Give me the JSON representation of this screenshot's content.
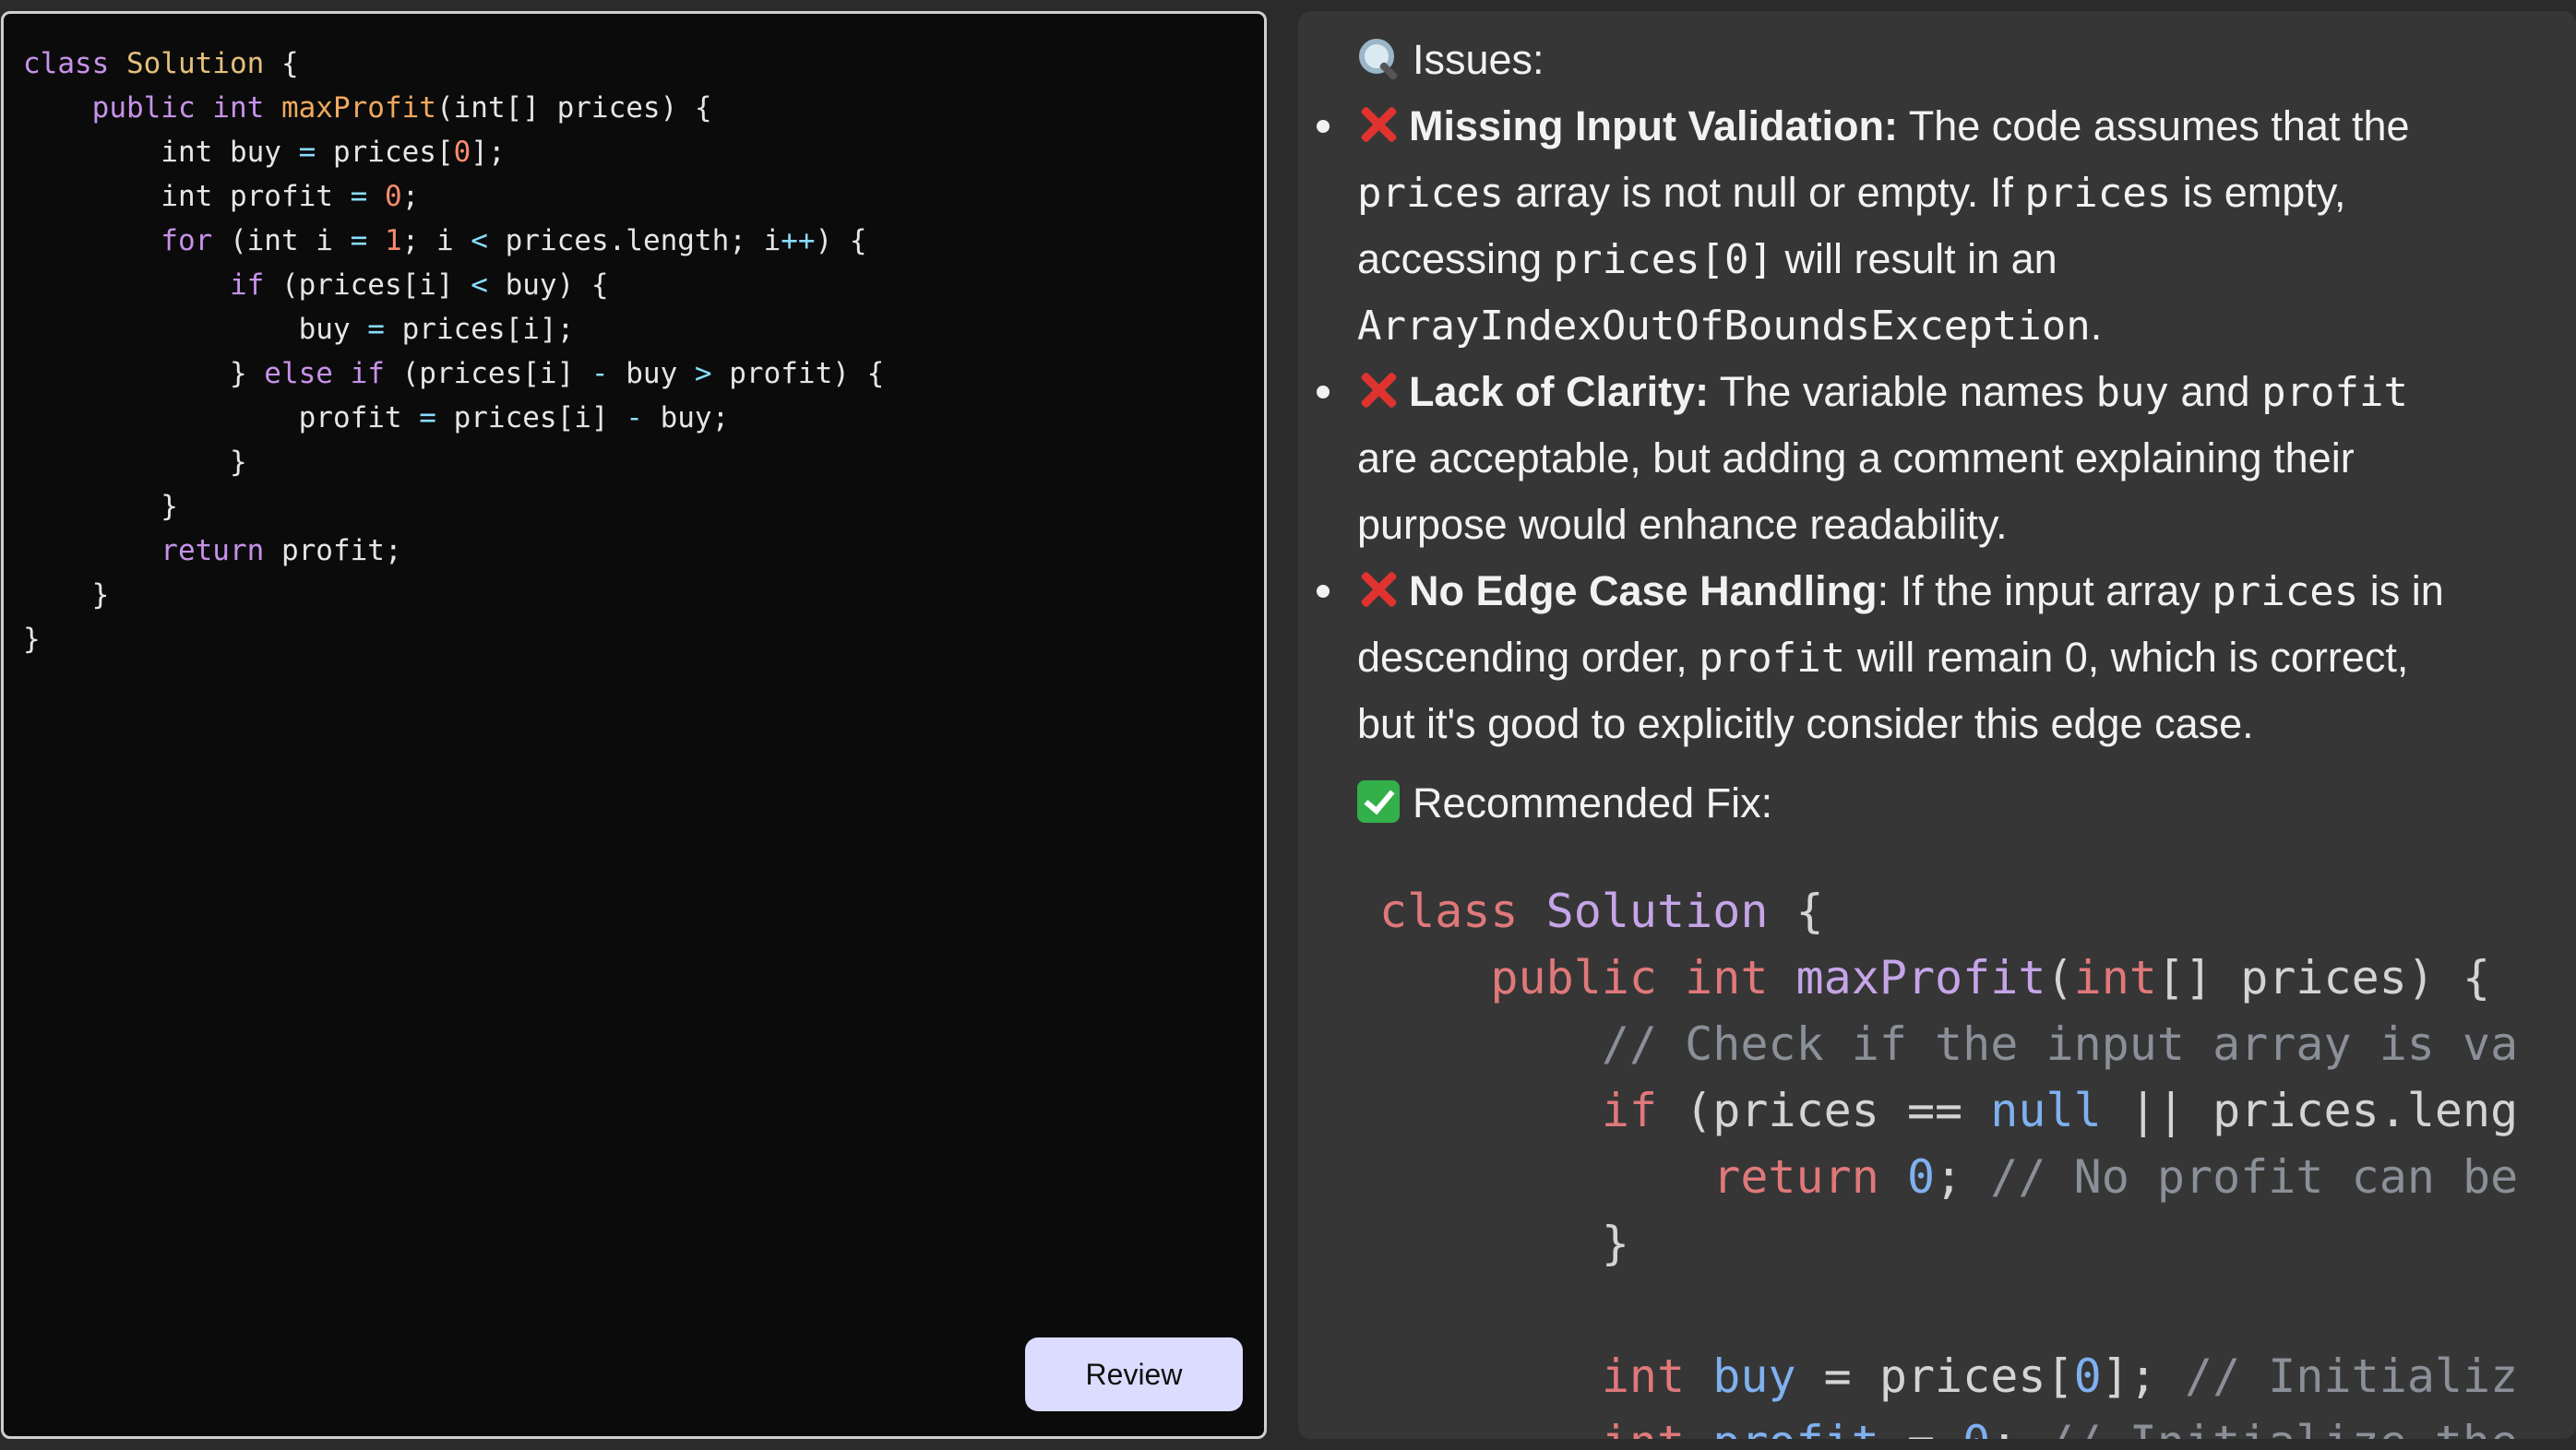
{
  "editor": {
    "colors": {
      "keyword": "#c792ea",
      "className": "#e5c07b",
      "method": "#f0a860",
      "number": "#f78c6c",
      "operator": "#89ddff",
      "plain": "#e6e6e6"
    },
    "code_lines": [
      [
        {
          "t": "class ",
          "c": "keyword"
        },
        {
          "t": "Solution",
          "c": "className"
        },
        {
          "t": " {",
          "c": "plain"
        }
      ],
      [
        {
          "t": "    public int ",
          "c": "keyword"
        },
        {
          "t": "maxProfit",
          "c": "method"
        },
        {
          "t": "(int[] prices) {",
          "c": "plain"
        }
      ],
      [
        {
          "t": "        int buy ",
          "c": "plain"
        },
        {
          "t": "=",
          "c": "operator"
        },
        {
          "t": " prices[",
          "c": "plain"
        },
        {
          "t": "0",
          "c": "number"
        },
        {
          "t": "];",
          "c": "plain"
        }
      ],
      [
        {
          "t": "        int profit ",
          "c": "plain"
        },
        {
          "t": "=",
          "c": "operator"
        },
        {
          "t": " ",
          "c": "plain"
        },
        {
          "t": "0",
          "c": "number"
        },
        {
          "t": ";",
          "c": "plain"
        }
      ],
      [
        {
          "t": "        for",
          "c": "keyword"
        },
        {
          "t": " (int i ",
          "c": "plain"
        },
        {
          "t": "=",
          "c": "operator"
        },
        {
          "t": " ",
          "c": "plain"
        },
        {
          "t": "1",
          "c": "number"
        },
        {
          "t": "; i ",
          "c": "plain"
        },
        {
          "t": "<",
          "c": "operator"
        },
        {
          "t": " prices.length; i",
          "c": "plain"
        },
        {
          "t": "++",
          "c": "operator"
        },
        {
          "t": ") {",
          "c": "plain"
        }
      ],
      [
        {
          "t": "            if",
          "c": "keyword"
        },
        {
          "t": " (prices[i] ",
          "c": "plain"
        },
        {
          "t": "<",
          "c": "operator"
        },
        {
          "t": " buy) {",
          "c": "plain"
        }
      ],
      [
        {
          "t": "                buy ",
          "c": "plain"
        },
        {
          "t": "=",
          "c": "operator"
        },
        {
          "t": " prices[i];",
          "c": "plain"
        }
      ],
      [
        {
          "t": "            } ",
          "c": "plain"
        },
        {
          "t": "else if",
          "c": "keyword"
        },
        {
          "t": " (prices[i] ",
          "c": "plain"
        },
        {
          "t": "-",
          "c": "operator"
        },
        {
          "t": " buy ",
          "c": "plain"
        },
        {
          "t": ">",
          "c": "operator"
        },
        {
          "t": " profit) {",
          "c": "plain"
        }
      ],
      [
        {
          "t": "                profit ",
          "c": "plain"
        },
        {
          "t": "=",
          "c": "operator"
        },
        {
          "t": " prices[i] ",
          "c": "plain"
        },
        {
          "t": "-",
          "c": "operator"
        },
        {
          "t": " buy;",
          "c": "plain"
        }
      ],
      [
        {
          "t": "            }",
          "c": "plain"
        }
      ],
      [
        {
          "t": "        }",
          "c": "plain"
        }
      ],
      [
        {
          "t": "        return",
          "c": "keyword"
        },
        {
          "t": " profit;",
          "c": "plain"
        }
      ],
      [
        {
          "t": "    }",
          "c": "plain"
        }
      ],
      [
        {
          "t": "}",
          "c": "plain"
        }
      ]
    ],
    "review_button_label": "Review"
  },
  "review": {
    "issues_heading": "Issues:",
    "issues": [
      {
        "title": "Missing Input Validation:",
        "lines": [
          [
            {
              "t": " The code assumes that the"
            }
          ],
          [
            {
              "t": "prices",
              "code": true
            },
            {
              "t": " array is not null or empty. If "
            },
            {
              "t": "prices",
              "code": true
            },
            {
              "t": " is empty,"
            }
          ],
          [
            {
              "t": "accessing "
            },
            {
              "t": "prices[0]",
              "code": true
            },
            {
              "t": " will result in an"
            }
          ],
          [
            {
              "t": "ArrayIndexOutOfBoundsException",
              "code": true
            },
            {
              "t": "."
            }
          ]
        ]
      },
      {
        "title": "Lack of Clarity:",
        "lines": [
          [
            {
              "t": " The variable names "
            },
            {
              "t": "buy",
              "code": true
            },
            {
              "t": " and "
            },
            {
              "t": "profit",
              "code": true
            }
          ],
          [
            {
              "t": "are acceptable, but adding a comment explaining their"
            }
          ],
          [
            {
              "t": "purpose would enhance readability."
            }
          ]
        ]
      },
      {
        "title": "No Edge Case Handling",
        "lines": [
          [
            {
              "t": ": If the input array "
            },
            {
              "t": "prices",
              "code": true
            },
            {
              "t": " is in"
            }
          ],
          [
            {
              "t": "descending order, "
            },
            {
              "t": "profit",
              "code": true
            },
            {
              "t": " will remain 0, which is correct,"
            }
          ],
          [
            {
              "t": "but it's good to explicitly consider this edge case."
            }
          ]
        ]
      }
    ],
    "fix_heading": "Recommended Fix:",
    "fix_colors": {
      "keyword": "#e0787a",
      "className": "#c5a5e8",
      "method": "#c5a5e8",
      "number": "#7fb0f0",
      "literal": "#7fb0f0",
      "comment": "#8a8f98",
      "plain": "#d4d4d4"
    },
    "fix_code_lines": [
      [
        {
          "t": "class ",
          "c": "keyword"
        },
        {
          "t": "Solution",
          "c": "className"
        },
        {
          "t": " {",
          "c": "plain"
        }
      ],
      [
        {
          "t": "    public int ",
          "c": "keyword"
        },
        {
          "t": "maxProfit",
          "c": "method"
        },
        {
          "t": "(",
          "c": "plain"
        },
        {
          "t": "int",
          "c": "keyword"
        },
        {
          "t": "[] prices) {",
          "c": "plain"
        }
      ],
      [
        {
          "t": "        // Check if the input array is vali",
          "c": "comment"
        }
      ],
      [
        {
          "t": "        if",
          "c": "keyword"
        },
        {
          "t": " (prices == ",
          "c": "plain"
        },
        {
          "t": "null",
          "c": "literal"
        },
        {
          "t": " || prices.length",
          "c": "plain"
        }
      ],
      [
        {
          "t": "            return ",
          "c": "keyword"
        },
        {
          "t": "0",
          "c": "number"
        },
        {
          "t": "; ",
          "c": "plain"
        },
        {
          "t": "// No profit can be m",
          "c": "comment"
        }
      ],
      [
        {
          "t": "        }",
          "c": "plain"
        }
      ],
      [
        {
          "t": "",
          "c": "plain"
        }
      ],
      [
        {
          "t": "        int ",
          "c": "keyword"
        },
        {
          "t": "buy",
          "c": "literal"
        },
        {
          "t": " = prices[",
          "c": "plain"
        },
        {
          "t": "0",
          "c": "number"
        },
        {
          "t": "]; ",
          "c": "plain"
        },
        {
          "t": "// Initialize",
          "c": "comment"
        }
      ],
      [
        {
          "t": "        int ",
          "c": "keyword"
        },
        {
          "t": "profit",
          "c": "literal"
        },
        {
          "t": " = ",
          "c": "plain"
        },
        {
          "t": "0",
          "c": "number"
        },
        {
          "t": "; ",
          "c": "plain"
        },
        {
          "t": "// Initialize the m",
          "c": "comment"
        }
      ]
    ]
  }
}
